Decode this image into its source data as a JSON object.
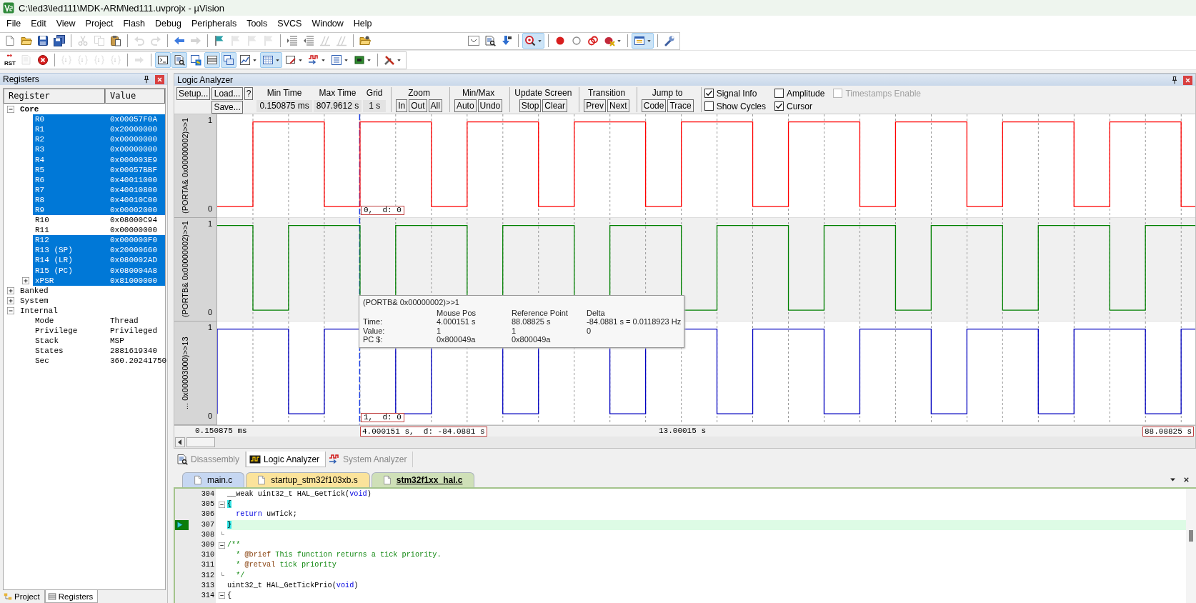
{
  "window": {
    "title": "C:\\led3\\led111\\MDK-ARM\\led111.uvprojx - µVision"
  },
  "menu": [
    "File",
    "Edit",
    "View",
    "Project",
    "Flash",
    "Debug",
    "Peripherals",
    "Tools",
    "SVCS",
    "Window",
    "Help"
  ],
  "toolbar_1": [
    {
      "pressed": false,
      "disabled": false
    },
    {
      "pressed": false,
      "disabled": false
    },
    {
      "pressed": false,
      "disabled": false
    },
    {
      "pressed": false,
      "disabled": false
    },
    {
      "pressed": false,
      "disabled": true
    },
    {
      "pressed": false,
      "disabled": true
    },
    {
      "pressed": false,
      "disabled": false
    },
    {
      "pressed": false,
      "disabled": true
    },
    {
      "pressed": false,
      "disabled": true
    },
    {
      "pressed": false,
      "disabled": false
    },
    {
      "pressed": false,
      "disabled": true
    },
    {
      "pressed": false,
      "disabled": false
    },
    {
      "pressed": false,
      "disabled": true
    },
    {
      "pressed": false,
      "disabled": true
    },
    {
      "pressed": false,
      "disabled": true
    },
    {
      "pressed": false,
      "disabled": false
    },
    {
      "pressed": false,
      "disabled": false
    },
    {
      "pressed": false,
      "disabled": true
    },
    {
      "pressed": false,
      "disabled": true
    },
    {
      "pressed": false,
      "disabled": false
    },
    {
      "pressed": false,
      "disabled": false
    },
    {
      "pressed": false,
      "disabled": false
    },
    {
      "pressed": false,
      "disabled": false
    },
    {
      "pressed": true,
      "disabled": false
    },
    {
      "pressed": false,
      "disabled": false
    },
    {
      "pressed": false,
      "disabled": false
    },
    {
      "pressed": false,
      "disabled": false
    },
    {
      "pressed": false,
      "disabled": false
    },
    {
      "pressed": true,
      "disabled": false
    },
    {
      "pressed": false,
      "disabled": false
    }
  ],
  "toolbar_2": [
    {
      "label": "RST",
      "pressed": false,
      "disabled": false
    },
    {
      "pressed": false,
      "disabled": true
    },
    {
      "pressed": false,
      "disabled": false
    },
    {
      "pressed": false,
      "disabled": true
    },
    {
      "pressed": false,
      "disabled": true
    },
    {
      "pressed": false,
      "disabled": true
    },
    {
      "pressed": false,
      "disabled": true
    },
    {
      "pressed": false,
      "disabled": true
    },
    {
      "pressed": true,
      "disabled": false
    },
    {
      "pressed": true,
      "disabled": false
    },
    {
      "pressed": false,
      "disabled": false
    },
    {
      "pressed": true,
      "disabled": false
    },
    {
      "pressed": true,
      "disabled": false
    },
    {
      "pressed": false,
      "disabled": false
    },
    {
      "pressed": true,
      "disabled": false
    },
    {
      "pressed": false,
      "disabled": false
    },
    {
      "pressed": false,
      "disabled": false
    },
    {
      "pressed": false,
      "disabled": false
    },
    {
      "pressed": false,
      "disabled": false
    },
    {
      "pressed": false,
      "disabled": false
    }
  ],
  "registers_panel": {
    "title": "Registers",
    "columns": [
      "Register",
      "Value"
    ],
    "tree": [
      {
        "name": "Core",
        "bold": true,
        "expanded": true,
        "children": [
          {
            "name": "R0",
            "value": "0x00057F0A",
            "highlighted": true
          },
          {
            "name": "R1",
            "value": "0x20000000",
            "highlighted": true
          },
          {
            "name": "R2",
            "value": "0x00000000",
            "highlighted": true
          },
          {
            "name": "R3",
            "value": "0x00000000",
            "highlighted": true
          },
          {
            "name": "R4",
            "value": "0x000003E9",
            "highlighted": true
          },
          {
            "name": "R5",
            "value": "0x00057BBF",
            "highlighted": true
          },
          {
            "name": "R6",
            "value": "0x40011000",
            "highlighted": true
          },
          {
            "name": "R7",
            "value": "0x40010800",
            "highlighted": true
          },
          {
            "name": "R8",
            "value": "0x40010C00",
            "highlighted": true
          },
          {
            "name": "R9",
            "value": "0x00002000",
            "highlighted": true
          },
          {
            "name": "R10",
            "value": "0x08000C94",
            "highlighted": false
          },
          {
            "name": "R11",
            "value": "0x00000000",
            "highlighted": false
          },
          {
            "name": "R12",
            "value": "0x000000F0",
            "highlighted": true
          },
          {
            "name": "R13 (SP)",
            "value": "0x20000660",
            "highlighted": true
          },
          {
            "name": "R14 (LR)",
            "value": "0x080002AD",
            "highlighted": true
          },
          {
            "name": "R15 (PC)",
            "value": "0x080004A8",
            "highlighted": true
          },
          {
            "name": "xPSR",
            "value": "0x81000000",
            "highlighted": true,
            "expanded": false
          }
        ]
      },
      {
        "name": "Banked",
        "bold": false,
        "expanded": false
      },
      {
        "name": "System",
        "bold": false,
        "expanded": false
      },
      {
        "name": "Internal",
        "bold": false,
        "expanded": true,
        "children": [
          {
            "name": "Mode",
            "value": "Thread",
            "highlighted": false
          },
          {
            "name": "Privilege",
            "value": "Privileged",
            "highlighted": false
          },
          {
            "name": "Stack",
            "value": "MSP",
            "highlighted": false
          },
          {
            "name": "States",
            "value": "2881619340",
            "highlighted": false
          },
          {
            "name": "Sec",
            "value": "360.20241750",
            "highlighted": false
          }
        ]
      }
    ],
    "tabs": [
      {
        "label": "Project",
        "selected": false
      },
      {
        "label": "Registers",
        "selected": true
      }
    ]
  },
  "logic_analyzer": {
    "title": "Logic Analyzer",
    "toolbar": {
      "setup": "Setup...",
      "load": "Load...",
      "save": "Save...",
      "help": "?",
      "fields": [
        {
          "label": "Min Time",
          "value": "0.150875 ms"
        },
        {
          "label": "Max Time",
          "value": "807.9612 s"
        },
        {
          "label": "Grid",
          "value": "1 s"
        }
      ],
      "groups": [
        {
          "label": "Zoom",
          "buttons": [
            "In",
            "Out",
            "All"
          ]
        },
        {
          "label": "Min/Max",
          "buttons": [
            "Auto",
            "Undo"
          ]
        },
        {
          "label": "Update Screen",
          "buttons": [
            "Stop",
            "Clear"
          ]
        },
        {
          "label": "Transition",
          "buttons": [
            "Prev",
            "Next"
          ]
        },
        {
          "label": "Jump to",
          "buttons": [
            "Code",
            "Trace"
          ]
        }
      ],
      "options": [
        {
          "label": "Signal Info",
          "checked": true,
          "disabled": false
        },
        {
          "label": "Amplitude",
          "checked": false,
          "disabled": false
        },
        {
          "label": "Timestamps Enable",
          "checked": false,
          "disabled": true
        },
        {
          "label": "Show Cycles",
          "checked": false,
          "disabled": false
        },
        {
          "label": "Cursor",
          "checked": true,
          "disabled": false
        }
      ]
    },
    "channels": [
      {
        "label": "(PORTA& 0x00000002)>>1",
        "high": "1",
        "low": "0",
        "color": "#ff0000",
        "selected": false,
        "readout": "0,  d: 0"
      },
      {
        "label": "(PORTB& 0x00000002)>>1",
        "high": "1",
        "low": "0",
        "color": "#008000",
        "selected": true
      },
      {
        "label": "... 0x00003000)>>13",
        "high": "1",
        "low": "0",
        "color": "#0000c0",
        "selected": false,
        "readout": "1,  d: 0"
      }
    ],
    "tooltip": {
      "title": "(PORTB& 0x00000002)>>1",
      "headers": [
        "Mouse Pos",
        "Reference Point",
        "Delta"
      ],
      "rows": [
        {
          "label": "Time:",
          "cells": [
            "4.000151 s",
            "88.08825 s",
            "-84.0881 s = 0.0118923 Hz"
          ]
        },
        {
          "label": "Value:",
          "cells": [
            "1",
            "1",
            "0"
          ]
        },
        {
          "label": "PC $:",
          "cells": [
            "0x800049a",
            "0x800049a"
          ]
        }
      ]
    },
    "time_axis": {
      "start": "0.150875 ms",
      "cursor": "4.000151 s,  d: -84.0881 s",
      "middle": "13.00015 s",
      "reference": "88.08825 s"
    }
  },
  "view_tabs": [
    {
      "label": "Disassembly",
      "selected": false
    },
    {
      "label": "Logic Analyzer",
      "selected": true
    },
    {
      "label": "System Analyzer",
      "selected": false
    }
  ],
  "editor": {
    "tabs": [
      {
        "label": "main.c",
        "color": "#c6d7f2",
        "selected": false
      },
      {
        "label": "startup_stm32f103xb.s",
        "color": "#fbe39b",
        "selected": false
      },
      {
        "label": "stm32f1xx_hal.c",
        "color": "#cfe0b8",
        "selected": true
      }
    ],
    "lines": [
      {
        "number": "304",
        "current": false,
        "indent": false,
        "fold_open": false,
        "fold_end": false,
        "segments": [
          {
            "kind": "plain",
            "text": "__weak uint32_t HAL_GetTick("
          },
          {
            "kind": "keyword",
            "text": "void"
          },
          {
            "kind": "plain",
            "text": ")"
          }
        ]
      },
      {
        "number": "305",
        "current": false,
        "indent": false,
        "fold_open": true,
        "fold_end": false,
        "segments": [
          {
            "kind": "brace",
            "text": "{"
          }
        ]
      },
      {
        "number": "306",
        "current": false,
        "indent": true,
        "fold_open": false,
        "fold_end": false,
        "segments": [
          {
            "kind": "keyword",
            "text": "return"
          },
          {
            "kind": "plain",
            "text": " uwTick;"
          }
        ]
      },
      {
        "number": "307",
        "current": true,
        "indent": false,
        "fold_open": false,
        "fold_end": false,
        "segments": [
          {
            "kind": "brace",
            "text": "}"
          }
        ]
      },
      {
        "number": "308",
        "current": false,
        "indent": false,
        "fold_open": false,
        "fold_end": true
      },
      {
        "number": "309",
        "current": false,
        "indent": false,
        "fold_open": true,
        "fold_end": false,
        "segments": [
          {
            "kind": "comment",
            "text": "/**"
          }
        ]
      },
      {
        "number": "310",
        "current": false,
        "indent": false,
        "fold_open": false,
        "fold_end": false,
        "segments": [
          {
            "kind": "comment",
            "text": "  * "
          },
          {
            "kind": "tag",
            "text": "@brief"
          },
          {
            "kind": "comment",
            "text": " This function returns a tick priority."
          }
        ]
      },
      {
        "number": "311",
        "current": false,
        "indent": false,
        "fold_open": false,
        "fold_end": false,
        "segments": [
          {
            "kind": "comment",
            "text": "  * "
          },
          {
            "kind": "tag",
            "text": "@retval"
          },
          {
            "kind": "comment",
            "text": " tick priority"
          }
        ]
      },
      {
        "number": "312",
        "current": false,
        "indent": false,
        "fold_open": false,
        "fold_end": true,
        "segments": [
          {
            "kind": "comment",
            "text": "  */"
          }
        ]
      },
      {
        "number": "313",
        "current": false,
        "indent": false,
        "fold_open": false,
        "fold_end": false,
        "segments": [
          {
            "kind": "plain",
            "text": "uint32_t HAL_GetTickPrio("
          },
          {
            "kind": "keyword",
            "text": "void"
          },
          {
            "kind": "plain",
            "text": ")"
          }
        ]
      },
      {
        "number": "314",
        "current": false,
        "indent": false,
        "fold_open": true,
        "fold_end": false,
        "segments": [
          {
            "kind": "plain",
            "text": "{"
          }
        ]
      }
    ]
  }
}
